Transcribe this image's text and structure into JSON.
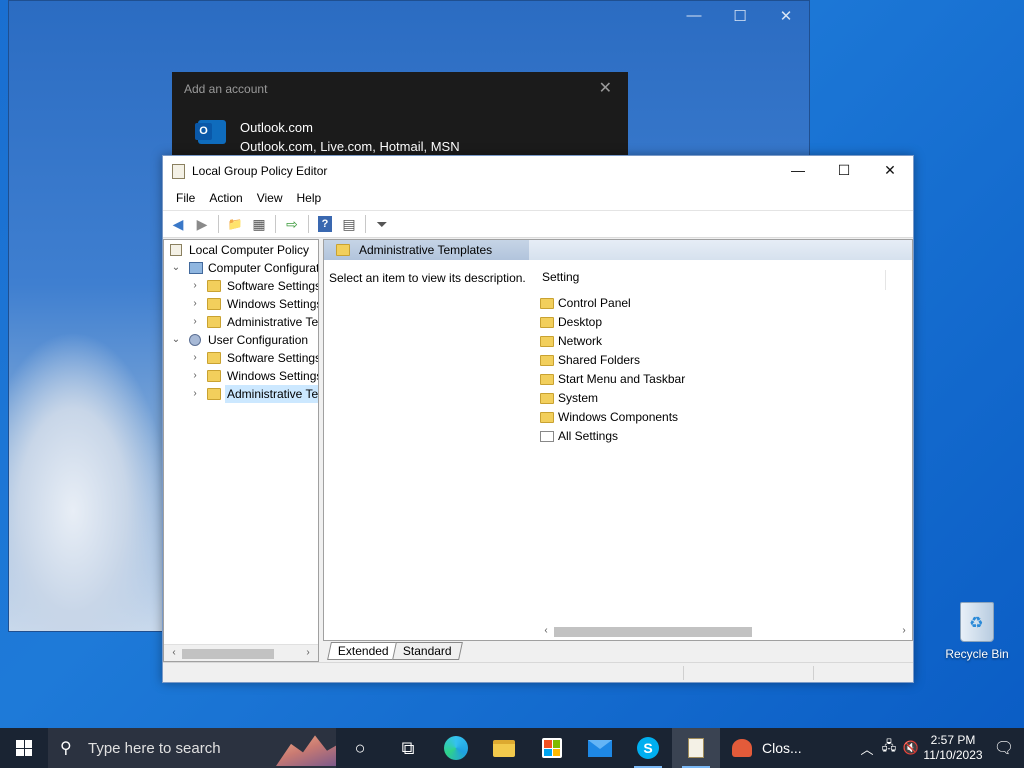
{
  "background_window": {
    "minimize": "—",
    "maximize": "☐",
    "close": "✕"
  },
  "account_dialog": {
    "title": "Add an account",
    "close": "✕",
    "provider_name": "Outlook.com",
    "provider_desc": "Outlook.com, Live.com, Hotmail, MSN"
  },
  "window": {
    "title": "Local Group Policy Editor",
    "minimize": "—",
    "maximize": "☐",
    "close": "✕"
  },
  "menu": [
    "File",
    "Action",
    "View",
    "Help"
  ],
  "toolbar": {
    "back": "◀",
    "forward": "▶",
    "up": "📁",
    "show_hide": "▦",
    "export": "⇨",
    "help": "?",
    "properties": "▤",
    "filter": "⏷"
  },
  "tree": [
    {
      "label": "Local Computer Policy",
      "expander": "",
      "icon": "policy-icon"
    },
    {
      "label": "Computer Configuration",
      "expander": "⌄",
      "icon": "computer-icon"
    },
    {
      "label": "Software Settings",
      "expander": "›",
      "icon": "folder-icon"
    },
    {
      "label": "Windows Settings",
      "expander": "›",
      "icon": "folder-icon"
    },
    {
      "label": "Administrative Templates",
      "expander": "›",
      "icon": "folder-icon"
    },
    {
      "label": "User Configuration",
      "expander": "⌄",
      "icon": "user-icon"
    },
    {
      "label": "Software Settings",
      "expander": "›",
      "icon": "folder-icon"
    },
    {
      "label": "Windows Settings",
      "expander": "›",
      "icon": "folder-icon"
    },
    {
      "label": "Administrative Templates",
      "expander": "›",
      "icon": "folder-icon",
      "selected": true
    }
  ],
  "scroll": {
    "left": "‹",
    "right": "›"
  },
  "right_pane": {
    "header": "Administrative Templates",
    "description": "Select an item to view its description.",
    "column_header": "Setting",
    "items": [
      {
        "label": "Control Panel",
        "icon": "folder-icon"
      },
      {
        "label": "Desktop",
        "icon": "folder-icon"
      },
      {
        "label": "Network",
        "icon": "folder-icon"
      },
      {
        "label": "Shared Folders",
        "icon": "folder-icon"
      },
      {
        "label": "Start Menu and Taskbar",
        "icon": "folder-icon"
      },
      {
        "label": "System",
        "icon": "folder-icon"
      },
      {
        "label": "Windows Components",
        "icon": "folder-icon"
      },
      {
        "label": "All Settings",
        "icon": "settings-list-icon"
      }
    ]
  },
  "tabs": [
    "Extended",
    "Standard"
  ],
  "desktop": {
    "recycle_bin": "Recycle Bin"
  },
  "taskbar": {
    "search_placeholder": "Type here to search",
    "search_icon": "⚲",
    "cortana": "○",
    "task_view": "⧉",
    "skype_letter": "S",
    "running_app_label": "Clos...",
    "tray": {
      "chevron": "︿",
      "network": "🖧",
      "volume": "🔇"
    },
    "time": "2:57 PM",
    "date": "11/10/2023",
    "notifications": "🗨"
  },
  "colors": {
    "desktop_bg": "#1a6fd1",
    "taskbar_bg": "#1a2433",
    "selection": "#cce8ff",
    "folder": "#f2cf5c"
  }
}
